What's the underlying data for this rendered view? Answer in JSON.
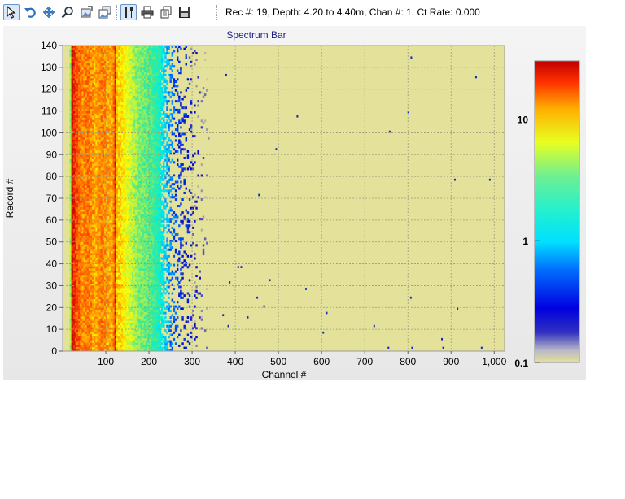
{
  "toolbar": {
    "buttons": [
      {
        "name": "pointer",
        "icon": "pointer-arrow-icon",
        "active": true
      },
      {
        "name": "undo",
        "icon": "undo-icon",
        "active": false
      },
      {
        "name": "pan",
        "icon": "pan-arrows-icon",
        "active": false
      },
      {
        "name": "zoom",
        "icon": "magnifier-icon",
        "active": false
      },
      {
        "name": "export-image",
        "icon": "image-export-icon",
        "active": false
      },
      {
        "name": "copy-image",
        "icon": "image-copy-icon",
        "active": false
      },
      {
        "name": "settings",
        "icon": "tools-icon",
        "active": true
      },
      {
        "name": "print",
        "icon": "printer-icon",
        "active": false
      },
      {
        "name": "copy",
        "icon": "copy-pages-icon",
        "active": false
      },
      {
        "name": "save",
        "icon": "floppy-disk-icon",
        "active": false
      }
    ],
    "status_text": "Rec #: 19, Depth: 4.20 to 4.40m, Chan #: 1, Ct Rate: 0.000"
  },
  "chart_data": {
    "type": "heatmap",
    "title": "Spectrum Bar",
    "xlabel": "Channel #",
    "ylabel": "Record #",
    "xlim": [
      0,
      1024
    ],
    "ylim": [
      0,
      140
    ],
    "x_ticks": [
      100,
      200,
      300,
      400,
      500,
      600,
      700,
      800,
      900,
      1000
    ],
    "x_tick_labels": [
      "100",
      "200",
      "300",
      "400",
      "500",
      "600",
      "700",
      "800",
      "900",
      "1,000"
    ],
    "y_ticks": [
      0,
      10,
      20,
      30,
      40,
      50,
      60,
      70,
      80,
      90,
      100,
      110,
      120,
      130,
      140
    ],
    "y_tick_labels": [
      "0",
      "10",
      "20",
      "30",
      "40",
      "50",
      "60",
      "70",
      "80",
      "90",
      "100",
      "110",
      "120",
      "130",
      "140"
    ],
    "grid": true,
    "background_color": "#e4e29a",
    "color_scale": {
      "scale": "log",
      "min": 0.1,
      "max": 30,
      "tick_values": [
        0.1,
        1,
        10
      ],
      "tick_labels": [
        "0.1",
        "1",
        "10"
      ],
      "colors": [
        "#e4e29a",
        "#0000c8",
        "#0050ff",
        "#00c8ff",
        "#00f0e0",
        "#40e890",
        "#b0f050",
        "#ffff00",
        "#ffa000",
        "#ff4000",
        "#c00000"
      ]
    },
    "channel_profile": [
      {
        "x": 0,
        "v": 0.1
      },
      {
        "x": 18,
        "v": 3.0
      },
      {
        "x": 22,
        "v": 25
      },
      {
        "x": 30,
        "v": 18
      },
      {
        "x": 45,
        "v": 11
      },
      {
        "x": 60,
        "v": 13
      },
      {
        "x": 75,
        "v": 9
      },
      {
        "x": 90,
        "v": 12
      },
      {
        "x": 105,
        "v": 10
      },
      {
        "x": 117,
        "v": 9
      },
      {
        "x": 121,
        "v": 30
      },
      {
        "x": 125,
        "v": 8
      },
      {
        "x": 140,
        "v": 6
      },
      {
        "x": 155,
        "v": 4
      },
      {
        "x": 175,
        "v": 2.5
      },
      {
        "x": 200,
        "v": 2.0
      },
      {
        "x": 220,
        "v": 1.4
      },
      {
        "x": 240,
        "v": 0.6
      },
      {
        "x": 260,
        "v": 0.3
      },
      {
        "x": 290,
        "v": 0.2
      },
      {
        "x": 335,
        "v": 0.1
      }
    ],
    "isolated_hits": [
      {
        "x": 377,
        "y": 126
      },
      {
        "x": 542,
        "y": 107
      },
      {
        "x": 493,
        "y": 92
      },
      {
        "x": 453,
        "y": 71
      },
      {
        "x": 405,
        "y": 38
      },
      {
        "x": 412,
        "y": 38
      },
      {
        "x": 385,
        "y": 31
      },
      {
        "x": 478,
        "y": 32
      },
      {
        "x": 562,
        "y": 28
      },
      {
        "x": 449,
        "y": 24
      },
      {
        "x": 465,
        "y": 20
      },
      {
        "x": 610,
        "y": 17
      },
      {
        "x": 370,
        "y": 16
      },
      {
        "x": 427,
        "y": 15
      },
      {
        "x": 382,
        "y": 11
      },
      {
        "x": 602,
        "y": 8
      },
      {
        "x": 720,
        "y": 11
      },
      {
        "x": 753,
        "y": 1
      },
      {
        "x": 808,
        "y": 1
      },
      {
        "x": 880,
        "y": 1
      },
      {
        "x": 969,
        "y": 1
      },
      {
        "x": 877,
        "y": 5
      },
      {
        "x": 913,
        "y": 19
      },
      {
        "x": 805,
        "y": 24
      },
      {
        "x": 756,
        "y": 100
      },
      {
        "x": 799,
        "y": 109
      },
      {
        "x": 806,
        "y": 134
      },
      {
        "x": 956,
        "y": 125
      },
      {
        "x": 907,
        "y": 78
      },
      {
        "x": 988,
        "y": 78
      }
    ]
  }
}
